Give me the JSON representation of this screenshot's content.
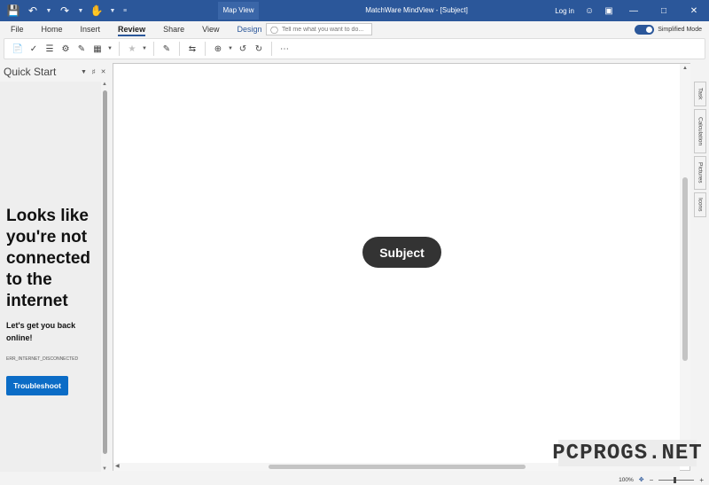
{
  "titlebar": {
    "map_view_tab": "Map View",
    "title": "MatchWare MindView - [Subject]",
    "login": "Log in"
  },
  "menu": {
    "tabs": [
      "File",
      "Home",
      "Insert",
      "Review",
      "Share",
      "View",
      "Design"
    ],
    "active_tab": "Review",
    "tell_me_placeholder": "Tell me what you want to do...",
    "simplified_mode_label": "Simplified Mode",
    "simplified_mode_on": true
  },
  "quick_start": {
    "title": "Quick Start",
    "offline_title": "Looks like you're not connected to the internet",
    "offline_subtitle": "Let's get you back online!",
    "error_code": "ERR_INTERNET_DISCONNECTED",
    "troubleshoot_label": "Troubleshoot"
  },
  "canvas": {
    "root_node": "Subject"
  },
  "side_tabs": [
    "Task",
    "Calculation",
    "Pictures",
    "Icons"
  ],
  "status": {
    "zoom": "100%"
  },
  "watermark": "PCPROGS.NET",
  "colors": {
    "accent": "#2b579a",
    "button": "#0b6cc6",
    "node_fill": "#333333"
  }
}
